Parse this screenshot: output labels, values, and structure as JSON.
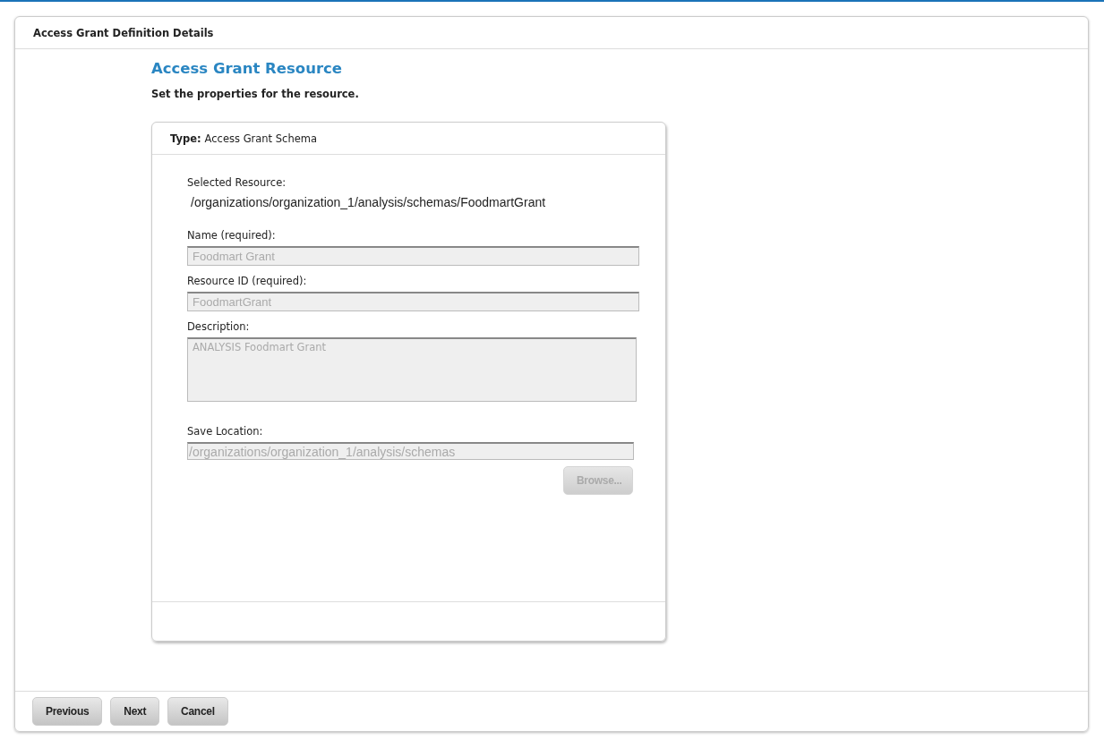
{
  "panel": {
    "title": "Access Grant Definition Details"
  },
  "heading": "Access Grant Resource",
  "subheading": "Set the properties for the resource.",
  "card": {
    "type_label": "Type:",
    "type_value": "Access Grant Schema",
    "selected_resource": {
      "label": "Selected Resource:",
      "value": "/organizations/organization_1/analysis/schemas/FoodmartGrant"
    },
    "fields": [
      {
        "kind": "input",
        "label": "Name (required):",
        "value": "Foodmart Grant",
        "disabled": true
      },
      {
        "kind": "input",
        "label": "Resource ID (required):",
        "value": "FoodmartGrant",
        "disabled": true
      },
      {
        "kind": "textarea",
        "label": "Description:",
        "value": "ANALYSIS Foodmart Grant",
        "disabled": true
      },
      {
        "kind": "location",
        "label": "Save Location:",
        "value": "/organizations/organization_1/analysis/schemas",
        "disabled": true
      }
    ],
    "browse": {
      "label": "Browse...",
      "disabled": true
    }
  },
  "buttons": [
    {
      "label": "Previous",
      "disabled": false
    },
    {
      "label": "Next",
      "disabled": false
    },
    {
      "label": "Cancel",
      "disabled": false
    }
  ]
}
